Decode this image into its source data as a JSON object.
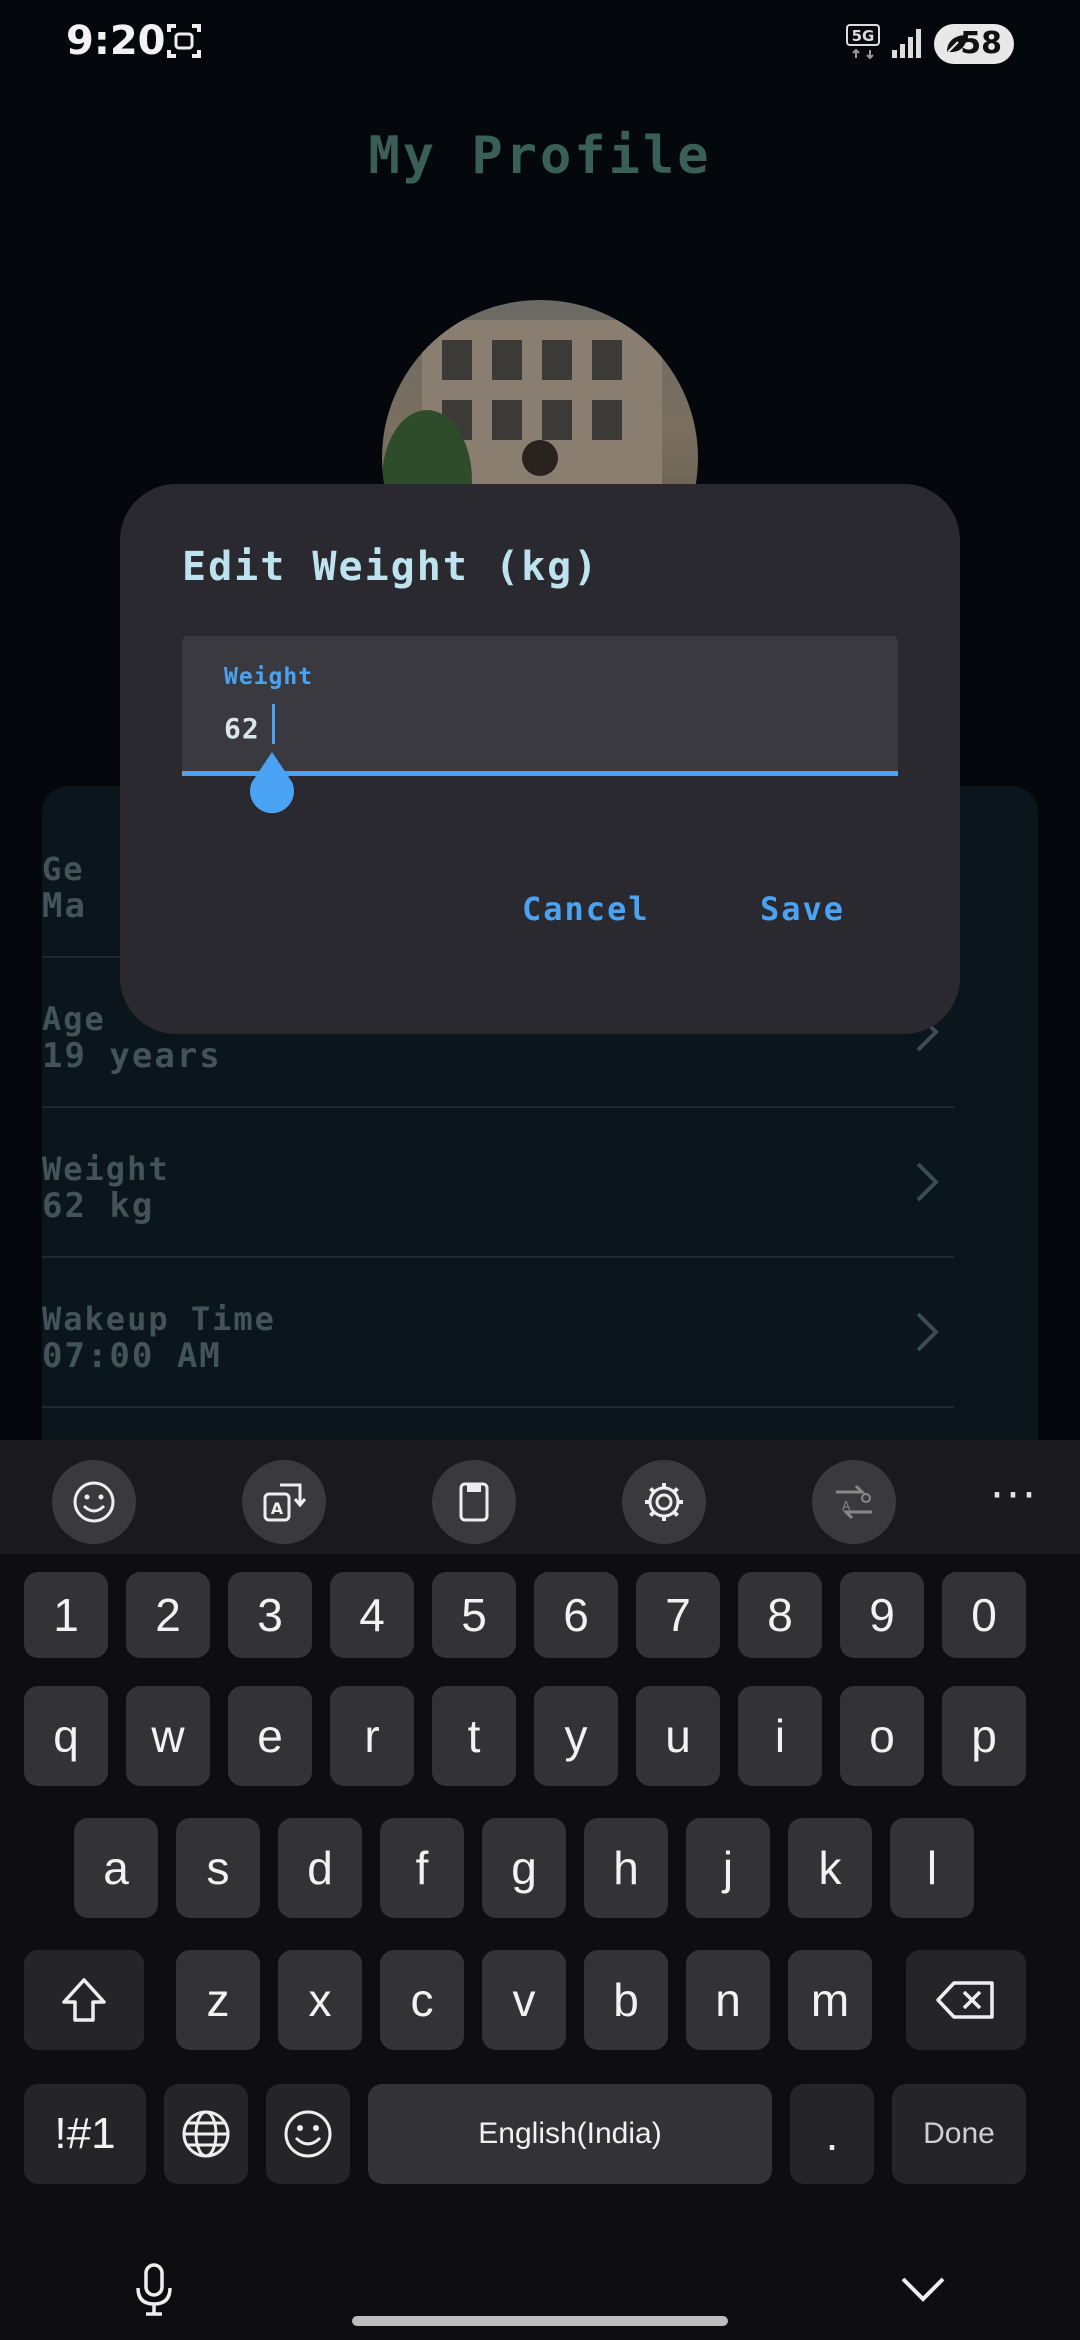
{
  "status_bar": {
    "time": "9:20",
    "network": "5G",
    "battery": "58",
    "icons": [
      "screen-record-icon",
      "5g-icon",
      "signal-icon",
      "battery-saver-icon"
    ]
  },
  "page": {
    "title": "My Profile",
    "rows": [
      {
        "label": "Ge",
        "value": "Ma"
      },
      {
        "label": "Age",
        "value": "19 years"
      },
      {
        "label": "Weight",
        "value": "62 kg"
      },
      {
        "label": "Wakeup Time",
        "value": "07:00 AM"
      }
    ]
  },
  "dialog": {
    "title": "Edit Weight (kg)",
    "field_label": "Weight",
    "field_value": "62",
    "cancel_label": "Cancel",
    "save_label": "Save"
  },
  "keyboard": {
    "toolbar_icons": [
      "emoji-icon",
      "text-transform-icon",
      "clipboard-icon",
      "settings-icon",
      "translate-icon",
      "more-icon"
    ],
    "more_label": "···",
    "row_numbers": [
      "1",
      "2",
      "3",
      "4",
      "5",
      "6",
      "7",
      "8",
      "9",
      "0"
    ],
    "row_top": [
      "q",
      "w",
      "e",
      "r",
      "t",
      "y",
      "u",
      "i",
      "o",
      "p"
    ],
    "row_middle": [
      "a",
      "s",
      "d",
      "f",
      "g",
      "h",
      "j",
      "k",
      "l"
    ],
    "row_bottom": [
      "z",
      "x",
      "c",
      "v",
      "b",
      "n",
      "m"
    ],
    "symbols_label": "!#1",
    "space_label": "English(India)",
    "period_label": ".",
    "done_label": "Done"
  },
  "colors": {
    "accent": "#4aa3f2",
    "dialog_bg": "#2a292f",
    "title_text": "#bfe3ee"
  }
}
